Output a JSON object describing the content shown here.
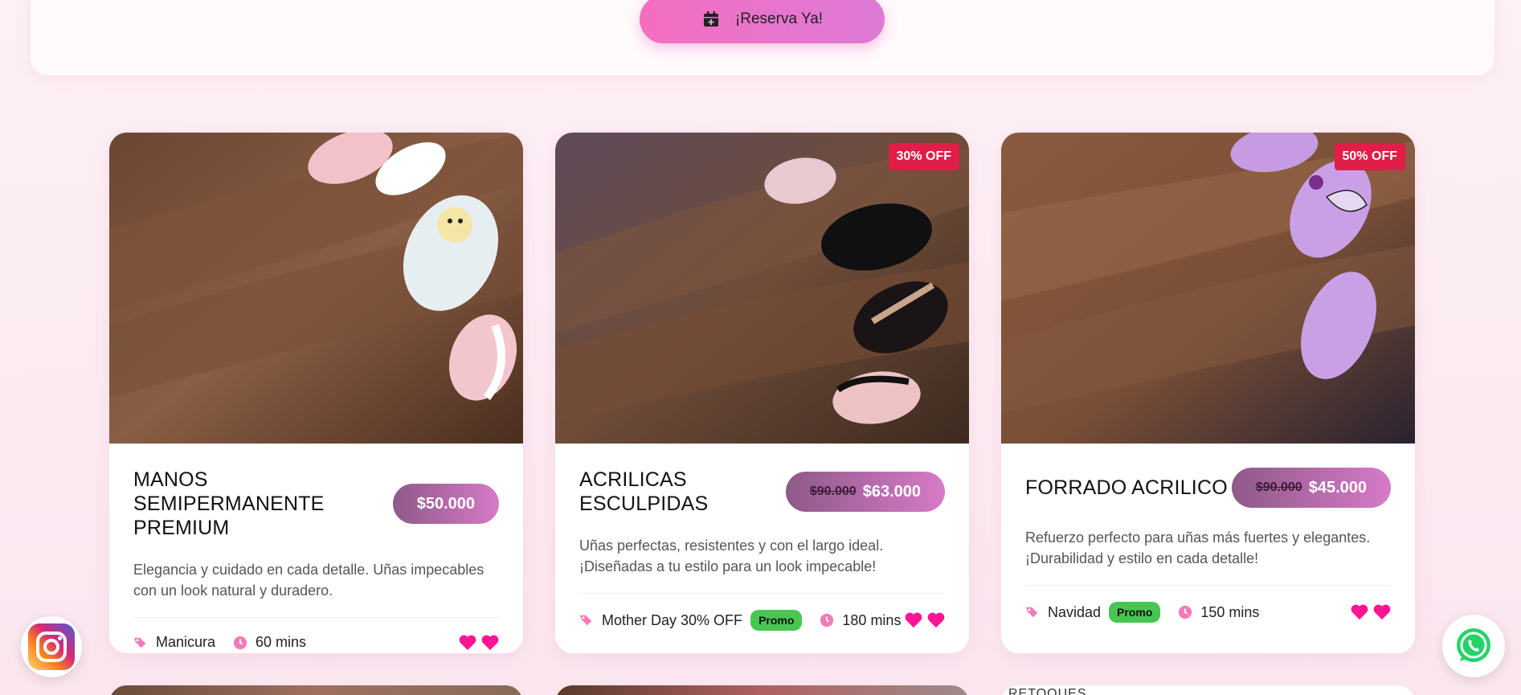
{
  "header": {
    "reserve_label": "¡Reserva Ya!"
  },
  "services": [
    {
      "title": "MANOS SEMIPERMANENTE PREMIUM",
      "price": "$50.000",
      "old_price": "",
      "discount": "",
      "description": "Elegancia y cuidado en cada detalle. Uñas impecables con un look natural y duradero.",
      "category": "Manicura",
      "promo": "",
      "duration": "60 mins"
    },
    {
      "title": "ACRILICAS ESCULPIDAS",
      "price": "$63.000",
      "old_price": "$90.000",
      "discount": "30% OFF",
      "description": "Uñas perfectas, resistentes y con el largo ideal. ¡Diseñadas a tu estilo para un look impecable!",
      "category": "Mother Day 30% OFF",
      "promo": "Promo",
      "duration": "180 mins"
    },
    {
      "title": "FORRADO ACRILICO",
      "price": "$45.000",
      "old_price": "$90.000",
      "discount": "50% OFF",
      "description": "Refuerzo perfecto para uñas más fuertes y elegantes. ¡Durabilidad y estilo en cada detalle!",
      "category": "Navidad",
      "promo": "Promo",
      "duration": "150 mins"
    }
  ],
  "peek_label": "RETOQUES",
  "colors": {
    "accent_pink": "#f46ec0",
    "heart": "#ff1493",
    "promo_green": "#47c752",
    "discount_red": "#e11d48"
  }
}
